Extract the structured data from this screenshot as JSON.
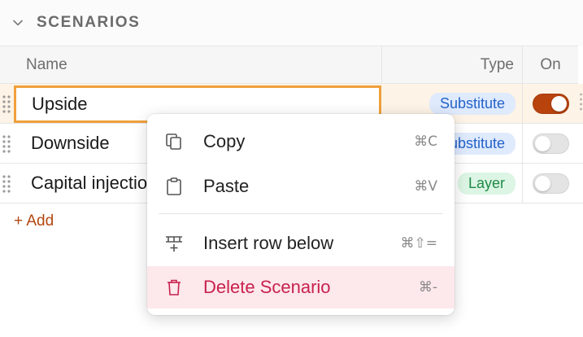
{
  "section": {
    "title": "SCENARIOS"
  },
  "columns": {
    "name": "Name",
    "type": "Type",
    "on": "On"
  },
  "rows": [
    {
      "name": "Upside",
      "type": "Substitute",
      "on": true,
      "selected": true
    },
    {
      "name": "Downside",
      "type": "Substitute",
      "on": false,
      "selected": false
    },
    {
      "name": "Capital injection",
      "type": "Layer",
      "on": false,
      "selected": false
    }
  ],
  "add_label": "+ Add",
  "context_menu": {
    "items": [
      {
        "label": "Copy",
        "shortcut": "⌘C",
        "icon": "copy-icon"
      },
      {
        "label": "Paste",
        "shortcut": "⌘V",
        "icon": "clipboard-icon"
      },
      {
        "label": "Insert row below",
        "shortcut": "⌘⇧=",
        "icon": "insert-row-icon"
      },
      {
        "label": "Delete Scenario",
        "shortcut": "⌘-",
        "icon": "trash-icon"
      }
    ]
  },
  "colors": {
    "accent": "#b8430d",
    "selection_border": "#f0a03c",
    "substitute_badge": "#2463c9",
    "layer_badge": "#1f8a47",
    "danger": "#c8214d"
  }
}
